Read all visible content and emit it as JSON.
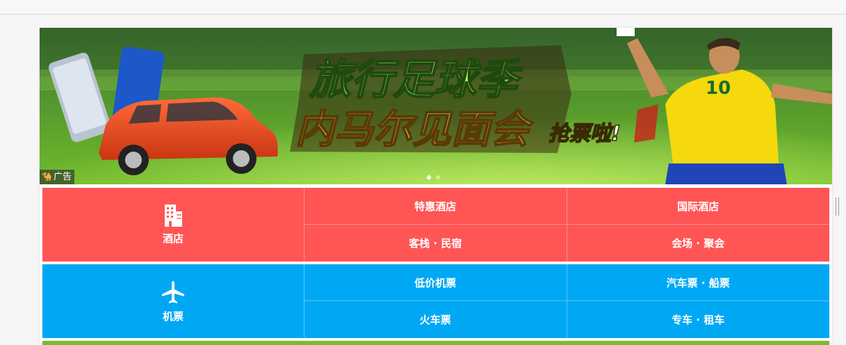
{
  "banner": {
    "headline_line1": "旅行足球季",
    "headline_line2": "内马尔见面会",
    "headline_tag": "抢票啦!",
    "jersey_number": "10",
    "ad_label": "广告",
    "slide_count": 2,
    "active_slide": 1
  },
  "sections": {
    "hotel": {
      "label": "酒店",
      "icon": "building-icon",
      "color": "#ff5555",
      "links": [
        "特惠酒店",
        "国际酒店",
        "客栈 · 民宿",
        "会场 · 聚会"
      ]
    },
    "flight": {
      "label": "机票",
      "icon": "airplane-icon",
      "color": "#00a8f4",
      "links": [
        "低价机票",
        "汽车票 · 船票",
        "火车票",
        "专车 · 租车"
      ]
    },
    "next_color": "#7fb832"
  }
}
